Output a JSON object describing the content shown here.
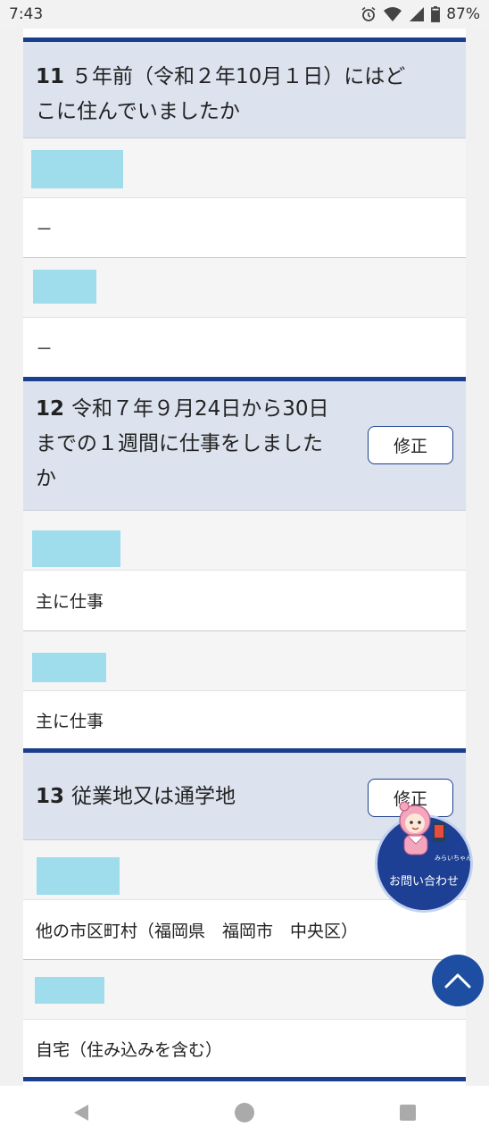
{
  "status_bar": {
    "time": "7:43",
    "battery": "87%",
    "icons": [
      "alarm-icon",
      "wifi-icon",
      "signal-icon",
      "battery-icon"
    ]
  },
  "questions": [
    {
      "number": "11",
      "title_lines": [
        "５年前（令和２年10月１日）にはど",
        "こに住んでいましたか"
      ],
      "answers": [
        "－",
        "－"
      ]
    },
    {
      "number": "12",
      "title_lines": [
        "令和７年９月24日から30日",
        "までの１週間に仕事をしました",
        "か"
      ],
      "edit_label": "修正",
      "answers": [
        "主に仕事",
        "主に仕事"
      ]
    },
    {
      "number": "13",
      "title_lines": [
        "従業地又は通学地"
      ],
      "edit_label": "修正",
      "answers": [
        "他の市区町村（福岡県　福岡市　中央区）",
        "自宅（住み込みを含む）"
      ]
    }
  ],
  "help": {
    "label": "お問い合わせ",
    "mascot_caption": "みらいちゃん"
  },
  "colors": {
    "accent": "#1b3f8c",
    "header_bg": "#dce3ee",
    "redaction": "#9fdcec",
    "button_blue": "#1d4ea2"
  },
  "nav_bar": {
    "icons": [
      "back-icon",
      "home-icon",
      "recents-icon"
    ]
  }
}
